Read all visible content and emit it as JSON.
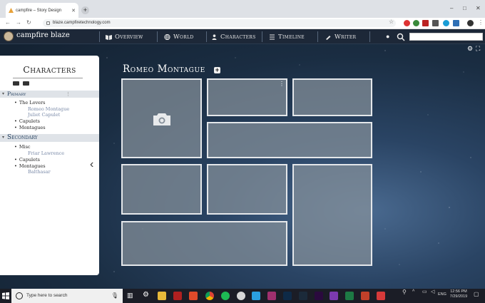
{
  "browser": {
    "tab_title": "campfire – Story Design",
    "new_tab": "+",
    "url": "blaze.campfiretechnology.com"
  },
  "app": {
    "brand": "campfire blaze",
    "nav": [
      {
        "label": "Overview",
        "icon": "book-icon"
      },
      {
        "label": "World",
        "icon": "globe-icon"
      },
      {
        "label": "Characters",
        "icon": "person-icon"
      },
      {
        "label": "Timeline",
        "icon": "timeline-icon"
      },
      {
        "label": "Writer",
        "icon": "pen-icon"
      }
    ]
  },
  "sidebar": {
    "title": "Characters",
    "groups": [
      {
        "label": "Primary",
        "items": [
          {
            "label": "The Lovers",
            "children": [
              "Romeo Montague",
              "Juliet Capulet"
            ]
          },
          {
            "label": "Capulets",
            "children": []
          },
          {
            "label": "Montagues",
            "children": []
          }
        ]
      },
      {
        "label": "Secondary",
        "items": [
          {
            "label": "Misc",
            "children": [
              "Friar Lawrence"
            ]
          },
          {
            "label": "Capulets",
            "children": []
          },
          {
            "label": "Montagues",
            "children": [
              "Balthasar"
            ]
          }
        ]
      }
    ],
    "collapse": "‹"
  },
  "main": {
    "title": "Romeo Montague",
    "add": "+"
  },
  "taskbar": {
    "search_placeholder": "Type here to search",
    "time": "12:56 PM",
    "date": "7/29/2019",
    "lang": "ENG"
  },
  "colors": {
    "app_bg": "#1a2d42",
    "tile": "#87919b",
    "accent": "#1e3a5a"
  }
}
